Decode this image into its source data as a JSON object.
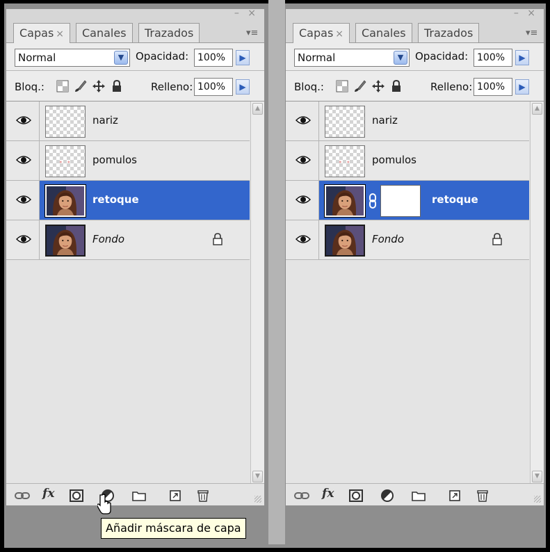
{
  "window_controls": "– ×",
  "tabs": [
    {
      "label": "Capas",
      "close": "×"
    },
    {
      "label": "Canales"
    },
    {
      "label": "Trazados"
    }
  ],
  "panel_menu_glyph": "▾≡",
  "blend_mode": "Normal",
  "opacity_label": "Opacidad:",
  "opacity_value": "100%",
  "lock_label": "Bloq.:",
  "fill_label": "Relleno:",
  "fill_value": "100%",
  "left_panel": {
    "layers": [
      {
        "name": "nariz",
        "thumb": "transparent"
      },
      {
        "name": "pomulos",
        "thumb": "transparent"
      },
      {
        "name": "retoque",
        "thumb": "photo",
        "selected": true
      },
      {
        "name": "Fondo",
        "thumb": "photo",
        "italic": true,
        "locked": true
      }
    ]
  },
  "right_panel": {
    "layers": [
      {
        "name": "nariz",
        "thumb": "transparent"
      },
      {
        "name": "pomulos",
        "thumb": "transparent"
      },
      {
        "name": "retoque",
        "thumb": "photo",
        "selected": true,
        "mask": true
      },
      {
        "name": "Fondo",
        "thumb": "photo",
        "italic": true,
        "locked": true
      }
    ]
  },
  "bottom_icons": [
    "link-icon",
    "fx-icon",
    "add-mask-icon",
    "adjustment-icon",
    "folder-icon",
    "new-layer-icon",
    "trash-icon"
  ],
  "fx_label": "fx",
  "tooltip": "Añadir máscara de capa",
  "colors": {
    "selection": "#3366cc",
    "panel_bg": "#e4e4e4",
    "tooltip_bg": "#ffffe1",
    "frame": "#000000"
  }
}
